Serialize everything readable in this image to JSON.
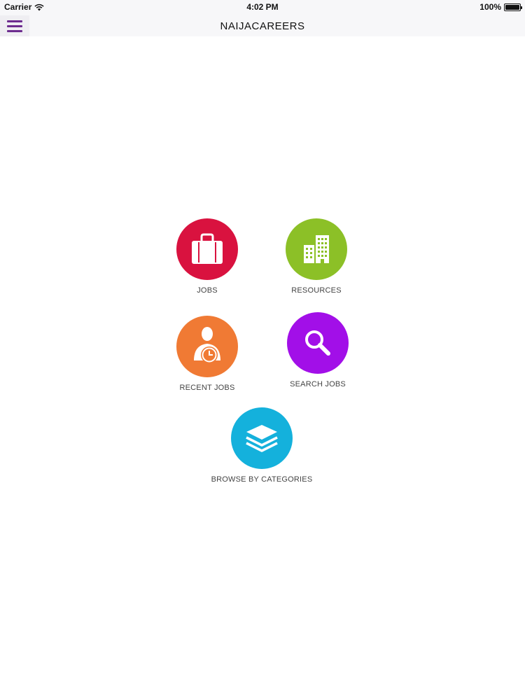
{
  "status_bar": {
    "carrier": "Carrier",
    "time": "4:02 PM",
    "battery": "100%",
    "battery_level": 1.0
  },
  "nav": {
    "title": "NAIJACAREERS",
    "menu_icon": "hamburger-menu-icon",
    "menu_color": "#6d2c8f"
  },
  "tiles": [
    {
      "label": "JOBS",
      "icon": "briefcase-icon",
      "color": "#d9123f"
    },
    {
      "label": "RESOURCES",
      "icon": "buildings-icon",
      "color": "#8cc027"
    },
    {
      "label": "RECENT JOBS",
      "icon": "person-clock-icon",
      "color": "#f07a34"
    },
    {
      "label": "SEARCH JOBS",
      "icon": "magnifier-icon",
      "color": "#a20fe8"
    },
    {
      "label": "BROWSE BY CATEGORIES",
      "icon": "layers-icon",
      "color": "#14b1dc"
    }
  ]
}
